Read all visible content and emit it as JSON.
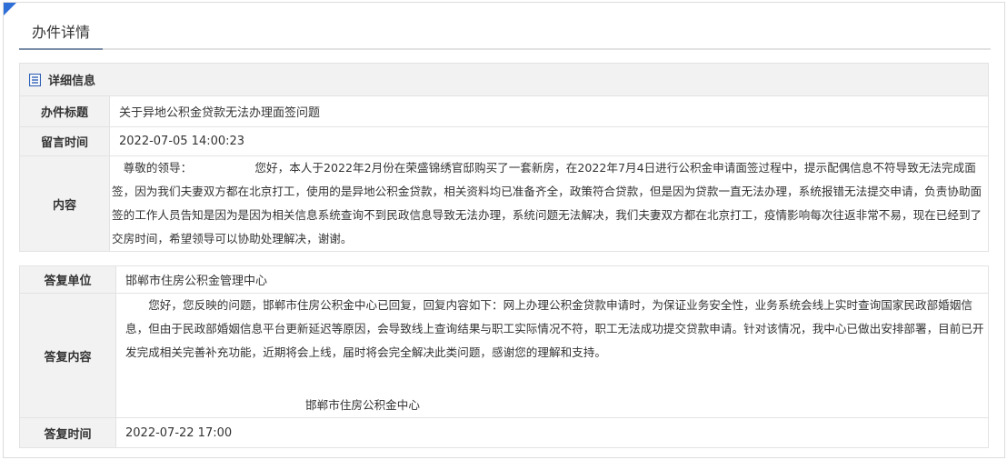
{
  "header": {
    "title": "办件详情"
  },
  "detail": {
    "section_title": "详细信息",
    "rows": [
      {
        "label": "办件标题",
        "value": "关于异地公积金贷款无法办理面签问题"
      },
      {
        "label": "留言时间",
        "value": "2022-07-05 14:00:23"
      }
    ],
    "content": {
      "label": "内容",
      "text": "　尊敬的领导：　　　　　　您好，本人于2022年2月份在荣盛锦绣官邸购买了一套新房，在2022年7月4日进行公积金申请面签过程中，提示配偶信息不符导致无法完成面签，因为我们夫妻双方都在北京打工，使用的是异地公积金贷款，相关资料均已准备齐全，政策符合贷款，但是因为贷款一直无法办理，系统报错无法提交申请，负责协助面签的工作人员告知是因为是因为相关信息系统查询不到民政信息导致无法办理，系统问题无法解决，我们夫妻双方都在北京打工，疫情影响每次往返非常不易，现在已经到了交房时间，希望领导可以协助处理解决，谢谢。"
    }
  },
  "reply": {
    "unit": {
      "label": "答复单位",
      "value": "邯郸市住房公积金管理中心"
    },
    "content": {
      "label": "答复内容",
      "text": "　　您好，您反映的问题，邯郸市住房公积金中心已回复，回复内容如下：网上办理公积金贷款申请时，为保证业务安全性，业务系统会线上实时查询国家民政部婚姻信息，但由于民政部婚姻信息平台更新延迟等原因，会导致线上查询结果与职工实际情况不符，职工无法成功提交贷款申请。针对该情况，我中心已做出安排部署，目前已开发完成相关完善补充功能，近期将会上线，届时将会完全解决此类问题，感谢您的理解和支持。",
      "signature": "邯郸市住房公积金中心"
    },
    "time": {
      "label": "答复时间",
      "value": "2022-07-22 17:00"
    }
  },
  "colors": {
    "accent": "#2f6fd8",
    "label_bg": "#f2f2f2",
    "border": "#e3e3e3"
  }
}
